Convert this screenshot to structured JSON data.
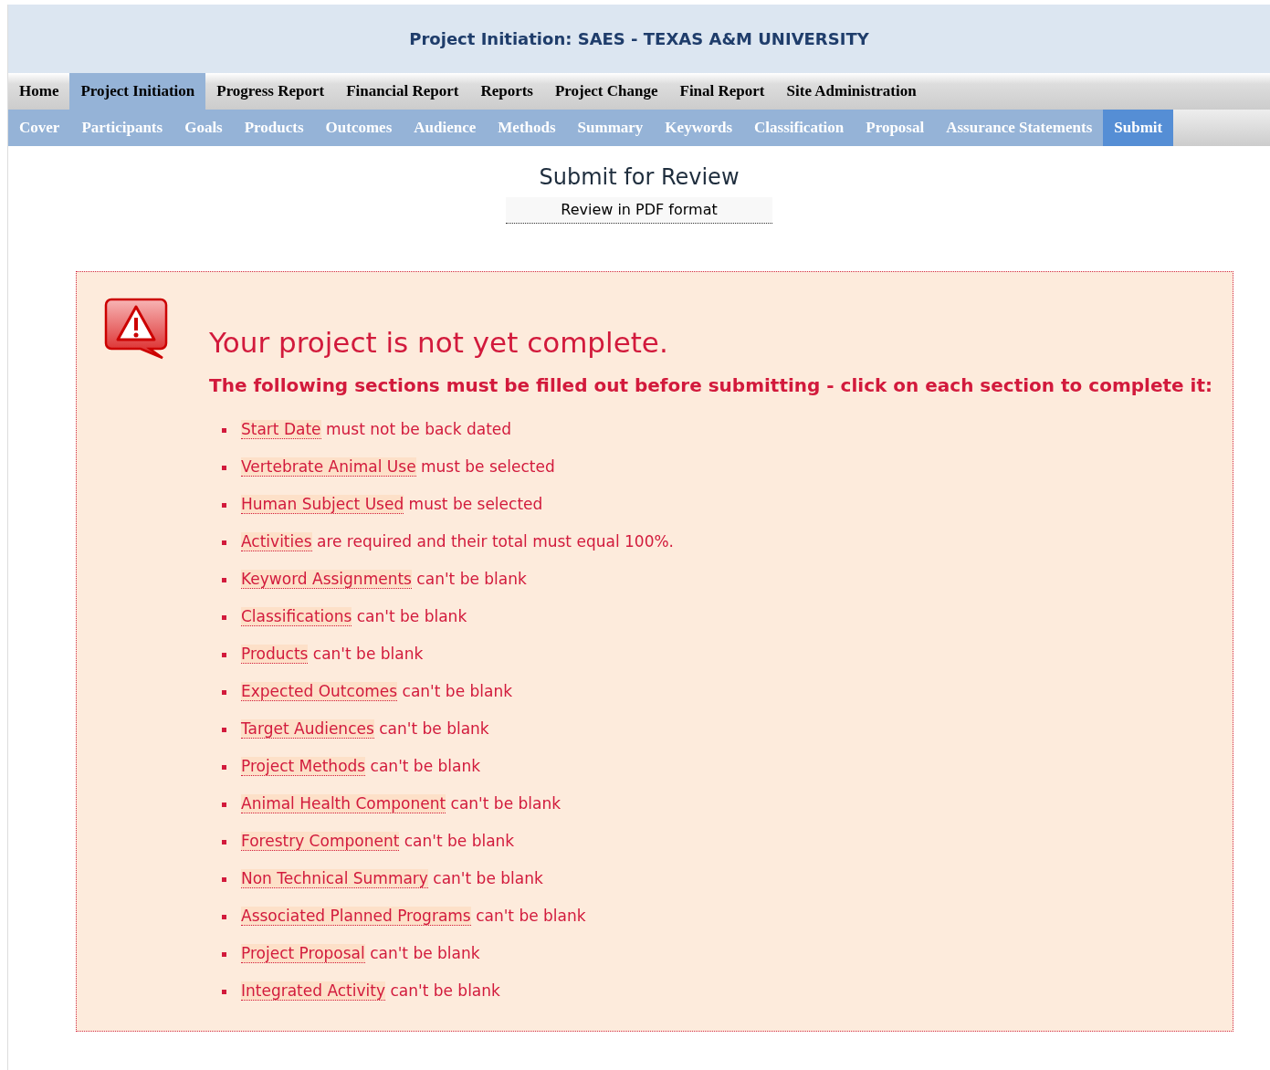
{
  "header": {
    "title": "Project Initiation: SAES - TEXAS A&M UNIVERSITY"
  },
  "main_nav": [
    {
      "label": "Home",
      "selected": false
    },
    {
      "label": "Project Initiation",
      "selected": true
    },
    {
      "label": "Progress Report",
      "selected": false
    },
    {
      "label": "Financial Report",
      "selected": false
    },
    {
      "label": "Reports",
      "selected": false
    },
    {
      "label": "Project Change",
      "selected": false
    },
    {
      "label": "Final Report",
      "selected": false
    },
    {
      "label": "Site Administration",
      "selected": false
    }
  ],
  "sub_nav": [
    {
      "label": "Cover",
      "selected": false
    },
    {
      "label": "Participants",
      "selected": false
    },
    {
      "label": "Goals",
      "selected": false
    },
    {
      "label": "Products",
      "selected": false
    },
    {
      "label": "Outcomes",
      "selected": false
    },
    {
      "label": "Audience",
      "selected": false
    },
    {
      "label": "Methods",
      "selected": false
    },
    {
      "label": "Summary",
      "selected": false
    },
    {
      "label": "Keywords",
      "selected": false
    },
    {
      "label": "Classification",
      "selected": false
    },
    {
      "label": "Proposal",
      "selected": false
    },
    {
      "label": "Assurance Statements",
      "selected": false
    },
    {
      "label": "Submit",
      "selected": true
    }
  ],
  "page_title": "Submit for Review",
  "review_link": "Review in PDF format",
  "alert": {
    "heading": "Your project is not yet complete.",
    "subheading": "The following sections must be filled out before submitting - click on each section to complete it:",
    "items": [
      {
        "link": "Start Date",
        "text": "must not be back dated"
      },
      {
        "link": "Vertebrate Animal Use",
        "text": "must be selected"
      },
      {
        "link": "Human Subject Used",
        "text": "must be selected"
      },
      {
        "link": "Activities",
        "text": "are required and their total must equal 100%."
      },
      {
        "link": "Keyword Assignments",
        "text": "can't be blank"
      },
      {
        "link": "Classifications",
        "text": "can't be blank"
      },
      {
        "link": "Products",
        "text": "can't be blank"
      },
      {
        "link": "Expected Outcomes",
        "text": "can't be blank"
      },
      {
        "link": "Target Audiences",
        "text": "can't be blank"
      },
      {
        "link": "Project Methods",
        "text": "can't be blank"
      },
      {
        "link": "Animal Health Component",
        "text": "can't be blank"
      },
      {
        "link": "Forestry Component",
        "text": "can't be blank"
      },
      {
        "link": "Non Technical Summary",
        "text": "can't be blank"
      },
      {
        "link": "Associated Planned Programs",
        "text": "can't be blank"
      },
      {
        "link": "Project Proposal",
        "text": "can't be blank"
      },
      {
        "link": "Integrated Activity",
        "text": "can't be blank"
      }
    ]
  }
}
